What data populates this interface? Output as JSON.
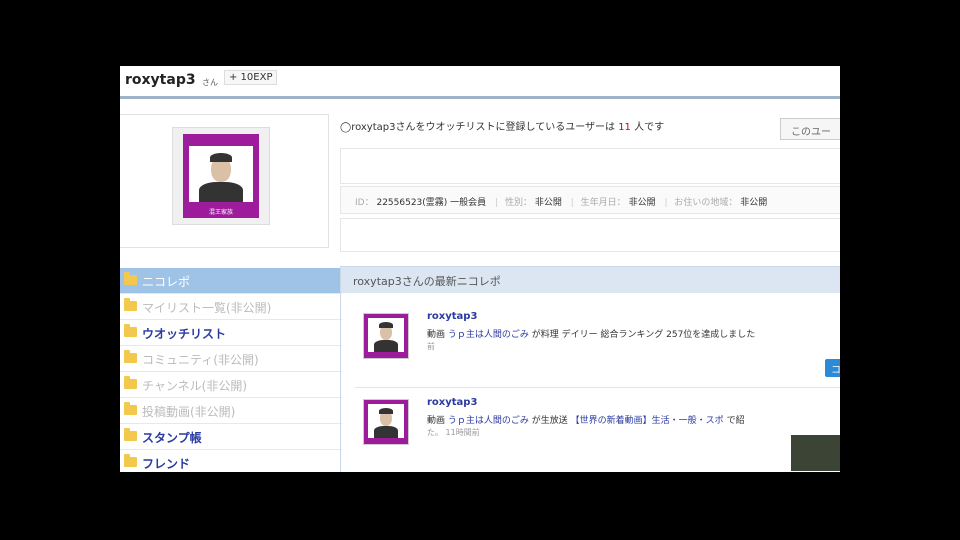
{
  "header": {
    "username": "roxytap3",
    "honorific": "さん",
    "exp": "+ 10EXP"
  },
  "profile": {
    "avatar_label": "混王家族",
    "watch_info_prefix": "◯roxytap3さんをウオッチリストに登録しているユーザーは",
    "watch_count": "11",
    "watch_info_suffix": "人です",
    "watch_button": "このユー",
    "id_label": "ID：",
    "id_value": "22556523(霊霧) 一般会員",
    "gender_label": "性別：",
    "gender_value": "非公開",
    "birth_label": "生年月日：",
    "birth_value": "非公開",
    "region_label": "お住いの地域：",
    "region_value": "非公開"
  },
  "sidebar": {
    "items": [
      {
        "label": "ニコレポ",
        "state": "active"
      },
      {
        "label": "マイリスト一覧(非公開)",
        "state": "disabled"
      },
      {
        "label": "ウオッチリスト",
        "state": "enabled"
      },
      {
        "label": "コミュニティ(非公開)",
        "state": "disabled"
      },
      {
        "label": "チャンネル(非公開)",
        "state": "disabled"
      },
      {
        "label": "投稿動画(非公開)",
        "state": "disabled"
      },
      {
        "label": "スタンプ帳",
        "state": "enabled"
      },
      {
        "label": "フレンド",
        "state": "enabled"
      }
    ]
  },
  "report": {
    "title": "roxytap3さんの最新ニコレポ",
    "items": [
      {
        "user": "roxytap3",
        "type": "動画",
        "video": "うｐ主は人間のごみ",
        "text_before_tag": "が料理",
        "tag": "",
        "text_after": "デイリー 総合ランキング 257位を達成しました",
        "time": "前"
      },
      {
        "user": "roxytap3",
        "type": "動画",
        "video": "うｐ主は人間のごみ",
        "text_before_tag": "が生放送",
        "tag": "【世界の新着動画】生活・一般・スポ",
        "text_after": "で紹",
        "time": "た。 11時間前"
      }
    ],
    "small_button": "コ"
  },
  "colors": {
    "accent_blue": "#2a3aa0",
    "sidebar_active": "#9fc3e7",
    "avatar_purple": "#9c1c9c",
    "count_red": "#dd0000"
  }
}
